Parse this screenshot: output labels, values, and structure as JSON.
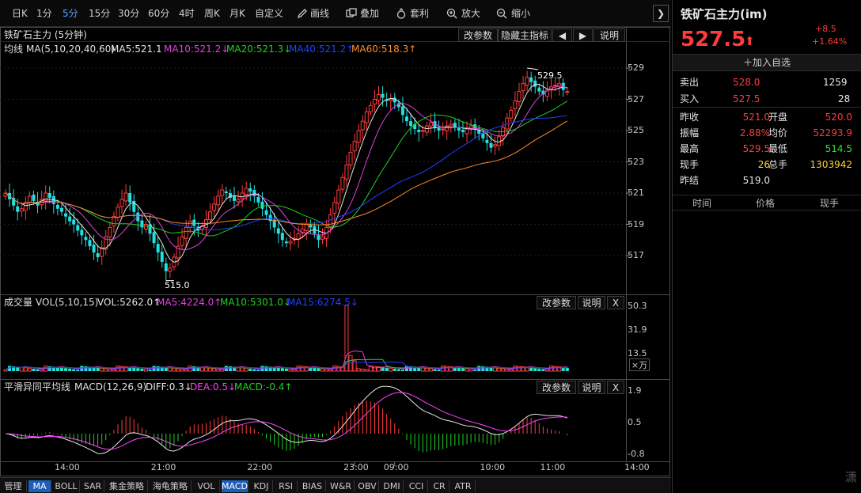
{
  "toolbar": {
    "periods": [
      "日K",
      "1分",
      "5分",
      "15分",
      "30分",
      "60分",
      "4时",
      "周K",
      "月K",
      "自定义"
    ],
    "active_period": "5分",
    "tools": [
      "画线",
      "叠加",
      "套利",
      "放大",
      "缩小"
    ]
  },
  "main_panel": {
    "title": "铁矿石主力 (5分钟)",
    "buttons": [
      "改参数",
      "隐藏主指标",
      "说明"
    ],
    "legend_name": "均线",
    "legend_params": "MA(5,10,20,40,60)",
    "legend": [
      {
        "label": "MA5:521.1",
        "color": "#e6e6e6"
      },
      {
        "label": "MA10:521.2↓",
        "color": "#e040e0"
      },
      {
        "label": "MA20:521.3↓",
        "color": "#20d020"
      },
      {
        "label": "MA40:521.2↑",
        "color": "#2040ff"
      },
      {
        "label": "MA60:518.3↑",
        "color": "#ff8c28"
      }
    ],
    "annotation_high": "529.5",
    "annotation_low": "515.0"
  },
  "volume_panel": {
    "legend_name": "成交量",
    "legend_params": "VOL(5,10,15)",
    "legend": [
      {
        "label": "VOL:5262.0↑",
        "color": "#e6e6e6"
      },
      {
        "label": "MA5:4224.0↑",
        "color": "#e040e0"
      },
      {
        "label": "MA10:5301.0↓",
        "color": "#20d020"
      },
      {
        "label": "MA15:6274.5↓",
        "color": "#2040ff"
      }
    ],
    "buttons": [
      "改参数",
      "说明",
      "X"
    ],
    "unit": "×万"
  },
  "macd_panel": {
    "legend_name": "平滑异同平均线",
    "legend_params": "MACD(12,26,9)",
    "legend": [
      {
        "label": "DIFF:0.3↓",
        "color": "#e6e6e6"
      },
      {
        "label": "DEA:0.5↓",
        "color": "#ff40ff"
      },
      {
        "label": "MACD:-0.4↑",
        "color": "#20d020"
      }
    ],
    "buttons": [
      "改参数",
      "说明",
      "X"
    ]
  },
  "bottom_tabs": [
    "管理",
    "MA",
    "BOLL",
    "SAR",
    "集金策略",
    "海龟策略",
    "VOL",
    "MACD",
    "KDJ",
    "RSI",
    "BIAS",
    "W&R",
    "OBV",
    "DMI",
    "CCI",
    "CR",
    "ATR"
  ],
  "active_tabs": [
    "MA",
    "MACD"
  ],
  "quote": {
    "name": "铁矿石主力(im)",
    "price": "527.5",
    "arrow": "⬆",
    "change": "+8.5",
    "change_pct": "+1.64%",
    "add_watch": "加入自选",
    "sell_label": "卖出",
    "sell_price": "528.0",
    "sell_vol": "1259",
    "buy_label": "买入",
    "buy_price": "527.5",
    "buy_vol": "28",
    "stats": [
      {
        "l1": "昨收",
        "v1": "521.0",
        "c1": "red",
        "l2": "开盘",
        "v2": "520.0",
        "c2": "red"
      },
      {
        "l1": "振幅",
        "v1": "2.88%",
        "c1": "red",
        "l2": "均价",
        "v2": "52293.9",
        "c2": "red"
      },
      {
        "l1": "最高",
        "v1": "529.5",
        "c1": "red",
        "l2": "最低",
        "v2": "514.5",
        "c2": "green"
      },
      {
        "l1": "现手",
        "v1": "26",
        "c1": "yellow",
        "l2": "总手",
        "v2": "1303942",
        "c2": "yellow"
      },
      {
        "l1": "昨结",
        "v1": "519.0",
        "c1": "white",
        "l2": "",
        "v2": "",
        "c2": "white"
      }
    ],
    "trade_headers": [
      "时间",
      "价格",
      "现手"
    ]
  },
  "chart_data": {
    "type": "candlestick",
    "x_ticks": [
      {
        "label": "14:00",
        "i": 15
      },
      {
        "label": "21:00",
        "i": 39
      },
      {
        "label": "22:00",
        "i": 63
      },
      {
        "label": "23:00",
        "i": 87
      },
      {
        "label": "09:00",
        "i": 97
      },
      {
        "label": "10:00",
        "i": 121
      },
      {
        "label": "11:00",
        "i": 136
      },
      {
        "label": "14:00",
        "i": 157
      }
    ],
    "price_axis": {
      "min": 515.0,
      "max": 530.0,
      "ticks": [
        529.0,
        527.0,
        525.0,
        523.0,
        521.0,
        519.0,
        517.0
      ]
    },
    "volume_axis": {
      "min": 0,
      "max": 50.3,
      "ticks": [
        50.3,
        31.9,
        13.5
      ]
    },
    "macd_axis": {
      "min": -0.8,
      "max": 1.9,
      "ticks": [
        1.9,
        0.5,
        -0.8
      ]
    },
    "close": [
      521.0,
      520.6,
      520.2,
      519.8,
      520.0,
      520.4,
      520.8,
      520.5,
      520.2,
      520.6,
      521.0,
      520.7,
      520.3,
      520.0,
      519.8,
      519.5,
      519.2,
      519.0,
      518.6,
      518.3,
      518.0,
      517.6,
      517.2,
      516.9,
      517.5,
      518.2,
      518.8,
      519.5,
      520.1,
      520.6,
      521.0,
      520.4,
      519.8,
      519.2,
      518.8,
      519.0,
      518.4,
      517.8,
      517.2,
      516.6,
      516.0,
      516.2,
      516.9,
      517.6,
      518.2,
      518.8,
      519.2,
      518.9,
      518.6,
      518.9,
      519.3,
      519.8,
      520.3,
      520.8,
      521.2,
      521.0,
      520.7,
      520.5,
      520.6,
      521.0,
      521.3,
      521.1,
      520.8,
      520.4,
      520.0,
      519.6,
      519.2,
      518.8,
      518.4,
      518.0,
      517.8,
      517.9,
      518.1,
      518.4,
      518.7,
      519.0,
      518.8,
      518.4,
      518.0,
      518.2,
      518.8,
      519.6,
      520.4,
      521.2,
      522.0,
      522.8,
      523.6,
      524.3,
      525.0,
      525.6,
      526.2,
      526.6,
      527.0,
      527.3,
      527.1,
      526.9,
      527.0,
      526.8,
      526.5,
      526.0,
      525.6,
      525.3,
      525.1,
      524.9,
      525.0,
      525.3,
      525.5,
      525.2,
      525.0,
      525.1,
      525.3,
      525.4,
      525.2,
      525.0,
      524.9,
      525.1,
      525.3,
      525.1,
      524.8,
      524.5,
      524.2,
      523.9,
      524.1,
      524.6,
      525.2,
      525.8,
      526.3,
      526.9,
      527.5,
      528.0,
      528.4,
      528.1,
      527.8,
      527.5,
      527.3,
      527.6,
      527.8,
      527.9,
      528.0,
      527.6,
      527.5
    ],
    "series": [
      {
        "name": "MA5",
        "color": "#e6e6e6"
      },
      {
        "name": "MA10",
        "color": "#e040e0"
      },
      {
        "name": "MA20",
        "color": "#20d020"
      },
      {
        "name": "MA40",
        "color": "#2040ff"
      },
      {
        "name": "MA60",
        "color": "#ff8c28"
      }
    ],
    "volume_spikes": [
      {
        "i": 85,
        "v": 50.3
      },
      {
        "i": 86,
        "v": 12.0
      },
      {
        "i": 87,
        "v": 8.0
      }
    ]
  }
}
